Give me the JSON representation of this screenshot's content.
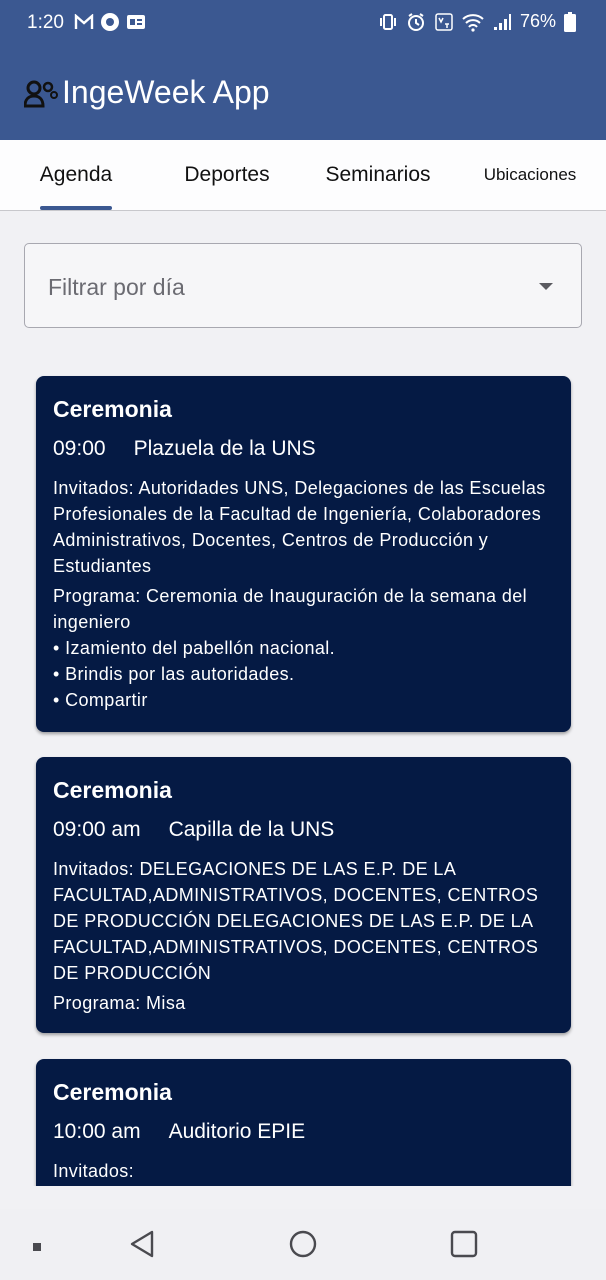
{
  "status_bar": {
    "time": "1:20",
    "battery": "76%"
  },
  "app": {
    "title": "IngeWeek App",
    "colors": {
      "primary": "#3b5891",
      "card": "#051a44"
    }
  },
  "tabs": [
    {
      "label": "Agenda",
      "active": true
    },
    {
      "label": "Deportes"
    },
    {
      "label": "Seminarios"
    },
    {
      "label": "Ubicaciones"
    }
  ],
  "filter": {
    "placeholder": "Filtrar por día"
  },
  "events": [
    {
      "title": "Ceremonia",
      "time": "09:00",
      "place": "Plazuela de la UNS",
      "invitados": "Invitados: Autoridades UNS, Delegaciones de las Escuelas Profesionales de la Facultad de Ingeniería, Colaboradores Administrativos, Docentes, Centros de Producción y Estudiantes",
      "programa": "Programa: Ceremonia de Inauguración de la semana del ingeniero",
      "items": [
        "• Izamiento del pabellón nacional.",
        "• Brindis por las autoridades.",
        "• Compartir"
      ]
    },
    {
      "title": "Ceremonia",
      "time": "09:00 am",
      "place": "Capilla de la UNS",
      "invitados": "Invitados: DELEGACIONES DE LAS E.P. DE LA FACULTAD,ADMINISTRATIVOS, DOCENTES, CENTROS DE PRODUCCIÓN DELEGACIONES DE LAS E.P. DE LA FACULTAD,ADMINISTRATIVOS, DOCENTES, CENTROS DE PRODUCCIÓN",
      "programa": "Programa: Misa"
    },
    {
      "title": "Ceremonia",
      "time": "10:00 am",
      "place": "Auditorio EPIE",
      "invitados": "Invitados:"
    }
  ]
}
